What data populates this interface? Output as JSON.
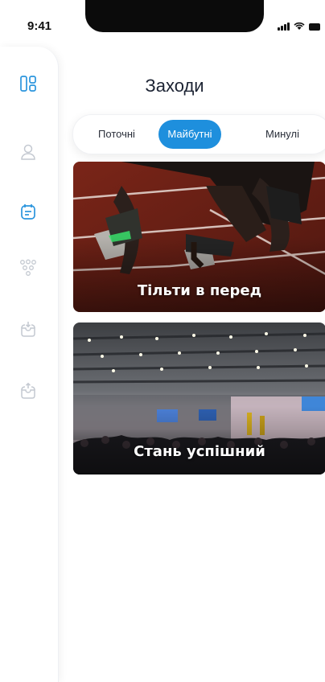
{
  "status": {
    "time": "9:41"
  },
  "sidebar": {
    "items": [
      {
        "icon": "dashboard-icon",
        "active": false
      },
      {
        "icon": "user-icon",
        "active": false
      },
      {
        "icon": "calendar-icon",
        "active": true
      },
      {
        "icon": "group-icon",
        "active": false
      },
      {
        "icon": "inbox-download-icon",
        "active": false
      },
      {
        "icon": "inbox-upload-icon",
        "active": false
      }
    ]
  },
  "header": {
    "title": "Заходи"
  },
  "tabs": [
    {
      "label": "Поточні",
      "active": false
    },
    {
      "label": "Майбутні",
      "active": true
    },
    {
      "label": "Минулі",
      "active": false
    }
  ],
  "events": [
    {
      "title": "Тільти в перед",
      "image": "running-track-photo"
    },
    {
      "title": "Стань успішний",
      "image": "conference-hall-photo"
    }
  ],
  "colors": {
    "accent": "#1e8fdd",
    "icon": "#2b95dd",
    "icon_muted": "#c4c9d1"
  }
}
